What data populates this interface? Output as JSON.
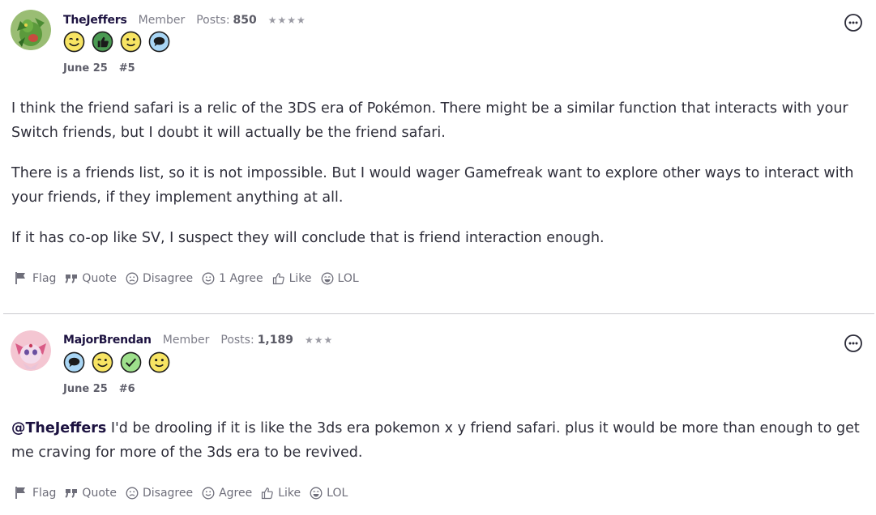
{
  "posts": [
    {
      "username": "TheJeffers",
      "role": "Member",
      "posts_label": "Posts:",
      "posts_count": "850",
      "stars": "★★★★",
      "badges": [
        "wink-face-icon",
        "thumbs-up-icon",
        "smile-face-icon",
        "speech-bubble-icon"
      ],
      "date": "June 25",
      "post_number": "#5",
      "paragraphs": [
        "I think the friend safari is a relic of the 3DS era of Pokémon. There might be a similar function that interacts with your Switch friends, but I doubt it will actually be the friend safari.",
        "There is a friends list, so it is not impossible. But I would wager Gamefreak want to explore other ways to interact with your friends, if they implement anything at all.",
        "If it has co-op like SV, I suspect they will conclude that is friend interaction enough."
      ],
      "actions": {
        "flag": "Flag",
        "quote": "Quote",
        "disagree": "Disagree",
        "agree": "1 Agree",
        "like": "Like",
        "lol": "LOL"
      }
    },
    {
      "username": "MajorBrendan",
      "role": "Member",
      "posts_label": "Posts:",
      "posts_count": "1,189",
      "stars": "★★★",
      "badges": [
        "speech-bubble-icon",
        "wink-face-icon",
        "checkmark-icon",
        "smile-face-icon"
      ],
      "date": "June 25",
      "post_number": "#6",
      "mention": "@TheJeffers",
      "text": " I'd be drooling if it is like the 3ds era pokemon x y friend safari. plus it would be more than enough to get me craving for more of the 3ds era to be revived.",
      "actions": {
        "flag": "Flag",
        "quote": "Quote",
        "disagree": "Disagree",
        "agree": "Agree",
        "like": "Like",
        "lol": "LOL"
      }
    }
  ],
  "colors": {
    "username": "#1c1240",
    "muted": "#7d7d89",
    "badge_yellow": "#f7e463",
    "badge_blue": "#a9d6f5",
    "badge_green": "#9ee08c",
    "badge_darkgreen": "#4a9a52"
  }
}
